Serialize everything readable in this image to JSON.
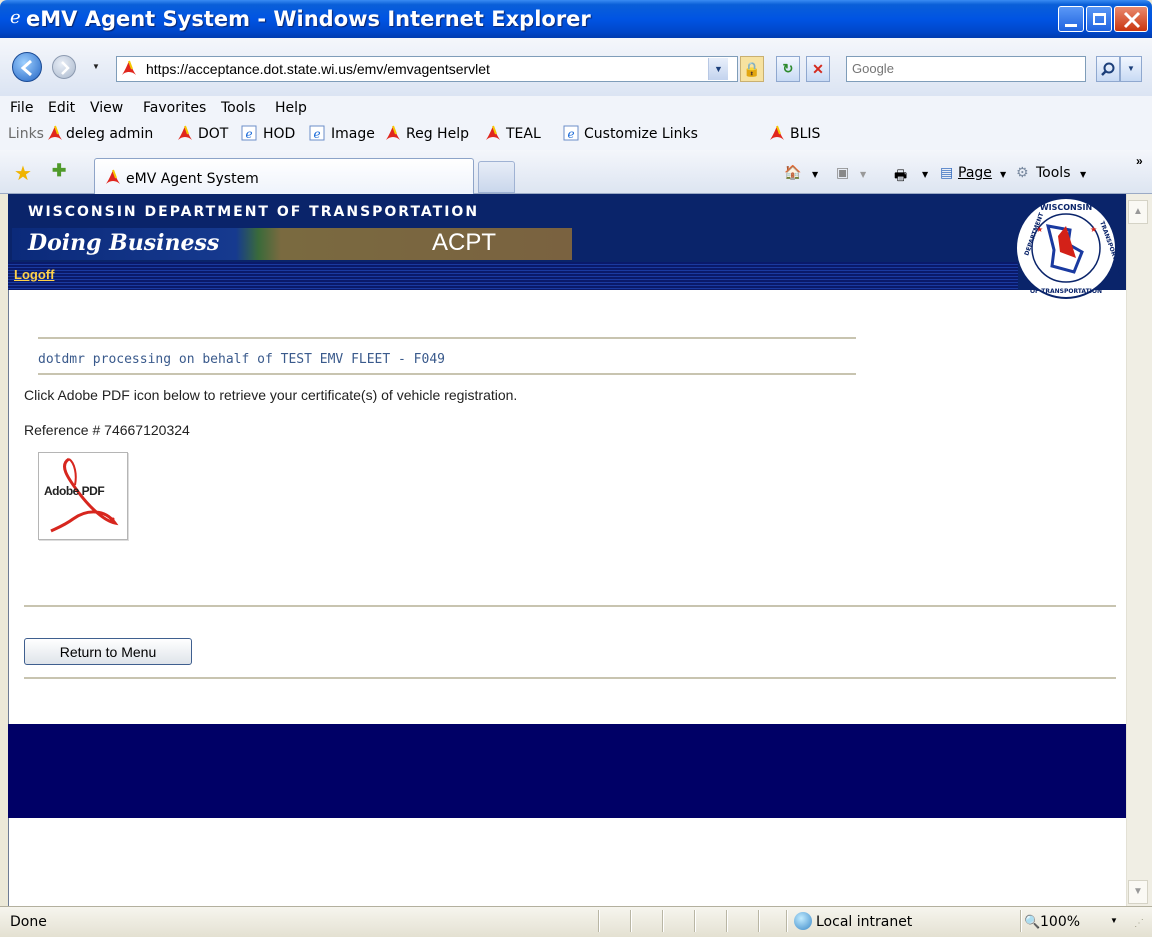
{
  "window": {
    "title": "eMV Agent System - Windows Internet Explorer",
    "accent": "#0054e3"
  },
  "address_bar": {
    "url": "https://acceptance.dot.state.wi.us/emv/emvagentservlet",
    "search_placeholder": "Google"
  },
  "menu": {
    "items": [
      {
        "label": "File"
      },
      {
        "label": "Edit"
      },
      {
        "label": "View"
      },
      {
        "label": "Favorites"
      },
      {
        "label": "Tools"
      },
      {
        "label": "Help"
      }
    ]
  },
  "links_bar": {
    "label": "Links",
    "items": [
      {
        "label": "deleg admin",
        "icon": "acrobat-icon"
      },
      {
        "label": "DOT",
        "icon": "acrobat-icon"
      },
      {
        "label": "HOD",
        "icon": "ie-page-icon"
      },
      {
        "label": "Image",
        "icon": "ie-page-icon"
      },
      {
        "label": "Reg Help",
        "icon": "acrobat-icon"
      },
      {
        "label": "TEAL",
        "icon": "acrobat-icon"
      },
      {
        "label": "Customize Links",
        "icon": "ie-page-icon"
      },
      {
        "label": "BLIS",
        "icon": "acrobat-icon"
      }
    ]
  },
  "tabs": {
    "active_label": "eMV Agent System",
    "commands": [
      {
        "label": "Page"
      },
      {
        "label": "Tools"
      }
    ]
  },
  "page": {
    "header_title": "WISCONSIN DEPARTMENT OF TRANSPORTATION",
    "doing_business": "Doing Business",
    "environment": "ACPT",
    "logoff_label": "Logoff",
    "seal_top": "WISCONSIN",
    "seal_left": "DEPARTMENT",
    "seal_right": "TRANSPORTATION",
    "seal_bottom": "OF TRANSPORTATION",
    "processing_line": "dotdmr processing on behalf of TEST EMV FLEET - F049",
    "instruction": "Click Adobe PDF icon below to retrieve your certificate(s) of vehicle registration.",
    "reference": "Reference # 74667120324",
    "pdf_icon_label": "Adobe PDF",
    "return_button": "Return to Menu",
    "header_color": "#0a246a",
    "footer_color": "#000066",
    "logoff_color": "#ffd24a"
  },
  "status_bar": {
    "status": "Done",
    "zone": "Local intranet",
    "zoom": "100%"
  }
}
